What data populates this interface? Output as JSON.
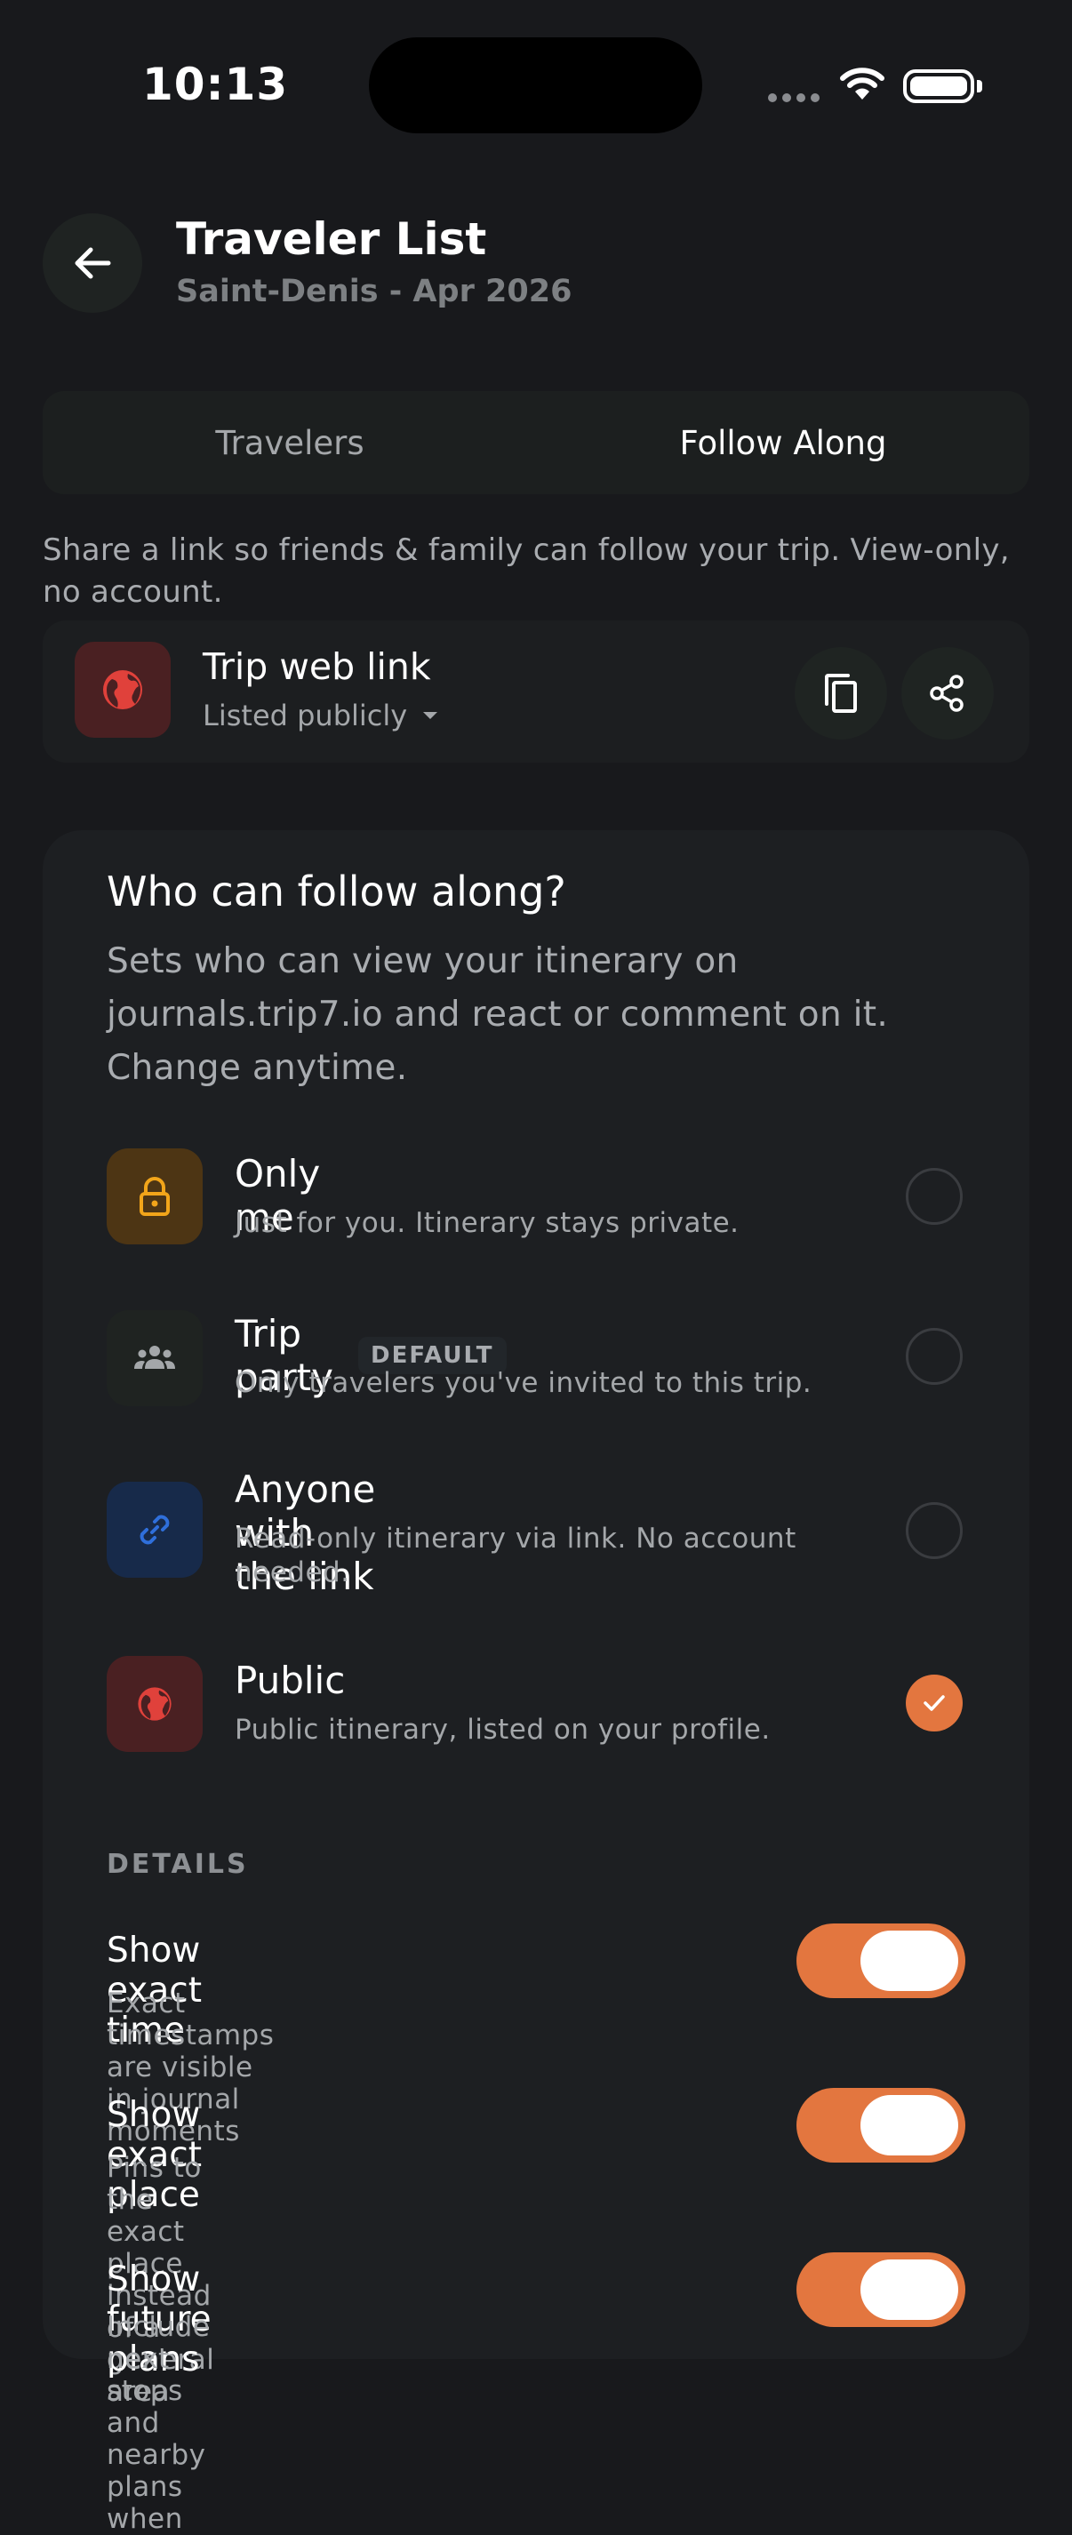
{
  "status_bar": {
    "time": "10:13"
  },
  "header": {
    "title": "Traveler List",
    "subtitle": "Saint-Denis - Apr 2026"
  },
  "tabs": [
    {
      "label": "Travelers",
      "active": false
    },
    {
      "label": "Follow Along",
      "active": true
    }
  ],
  "intro_text": "Share a link so friends & family can follow your trip. View-only, no account.",
  "link_card": {
    "title": "Trip web link",
    "visibility": "Listed publicly"
  },
  "follow": {
    "title": "Who can follow along?",
    "description": "Sets who can view your itinerary on journals.trip7.io and react or comment on it. Change anytime.",
    "options": [
      {
        "title": "Only me",
        "subtitle": "Just for you. Itinerary stays private.",
        "icon": "lock-icon",
        "selected": false
      },
      {
        "title": "Trip party",
        "badge": "DEFAULT",
        "subtitle": "Only travelers you've invited to this trip.",
        "icon": "group-icon",
        "selected": false
      },
      {
        "title": "Anyone with the link",
        "subtitle": "Read-only itinerary via link. No account needed.",
        "icon": "link-icon",
        "selected": false
      },
      {
        "title": "Public",
        "subtitle": "Public itinerary, listed on your profile.",
        "icon": "globe-icon",
        "selected": true
      }
    ]
  },
  "details": {
    "heading": "DETAILS",
    "toggles": [
      {
        "title": "Show exact time",
        "subtitle": "Exact timestamps are visible in journal moments",
        "on": true
      },
      {
        "title": "Show exact place",
        "subtitle": "Pins to the exact place instead of a general area",
        "on": true
      },
      {
        "title": "Show future plans",
        "subtitle": "Include next stops and nearby plans when",
        "on": true
      }
    ]
  },
  "colors": {
    "accent": "#e3763f",
    "background": "#18191c",
    "card": "#1d1f22",
    "globe": "#e0413b",
    "lock": "#f2a51a",
    "link": "#2f6fdb"
  }
}
